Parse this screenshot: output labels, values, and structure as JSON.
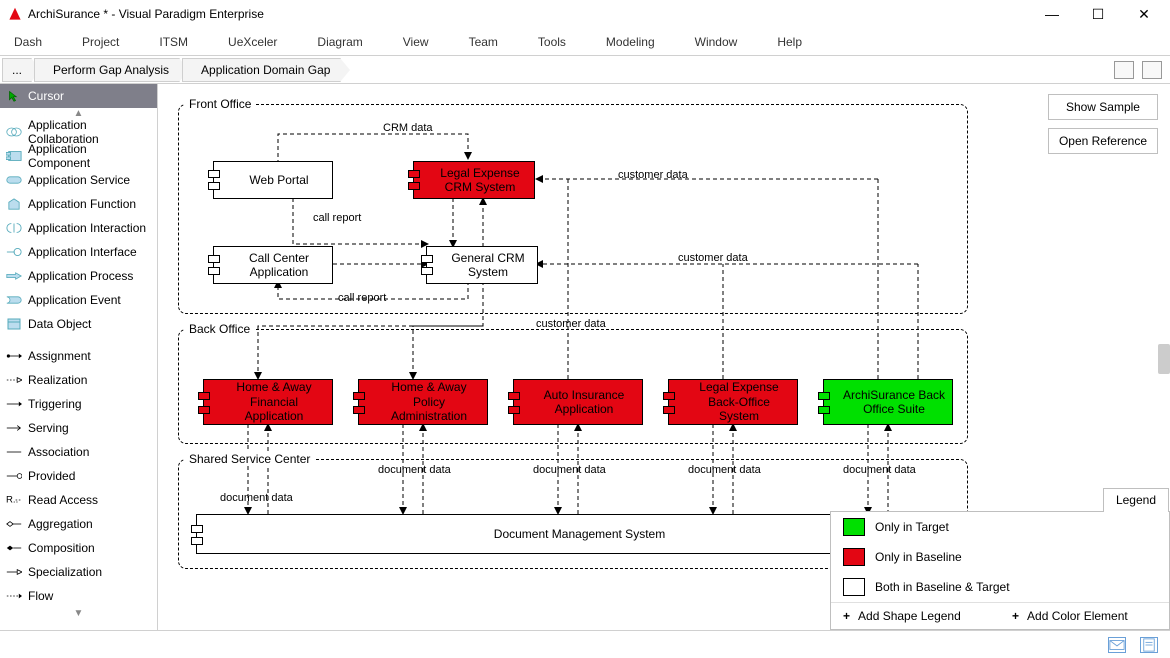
{
  "window": {
    "title": "ArchiSurance * - Visual Paradigm Enterprise"
  },
  "menu": {
    "items": [
      "Dash",
      "Project",
      "ITSM",
      "UeXceler",
      "Diagram",
      "View",
      "Team",
      "Tools",
      "Modeling",
      "Window",
      "Help"
    ]
  },
  "breadcrumb": {
    "root": "...",
    "items": [
      "Perform Gap Analysis",
      "Application Domain Gap"
    ]
  },
  "palette": {
    "selected": "Cursor",
    "shapes": [
      "Application Collaboration",
      "Application Component",
      "Application Service",
      "Application Function",
      "Application Interaction",
      "Application Interface",
      "Application Process",
      "Application Event",
      "Data Object"
    ],
    "connectors": [
      "Assignment",
      "Realization",
      "Triggering",
      "Serving",
      "Association",
      "Provided",
      "Read Access",
      "Aggregation",
      "Composition",
      "Specialization",
      "Flow"
    ]
  },
  "actions": {
    "sample": "Show Sample",
    "reference": "Open Reference"
  },
  "diagram": {
    "groups": {
      "front": {
        "label": "Front Office"
      },
      "back": {
        "label": "Back Office"
      },
      "shared": {
        "label": "Shared Service Center"
      }
    },
    "components": {
      "web_portal": "Web Portal",
      "legal_crm": "Legal Expense CRM System",
      "call_center": "Call Center Application",
      "general_crm": "General CRM System",
      "home_fin": "Home & Away Financial Application",
      "home_pol": "Home & Away Policy Administration",
      "auto_ins": "Auto Insurance Application",
      "legal_back": "Legal Expense Back-Office System",
      "archi_suite": "ArchiSurance Back Office Suite",
      "doc_mgmt": "Document Management System"
    },
    "labels": {
      "crm_data": "CRM data",
      "customer_data": "customer data",
      "customer_data2": "customer data",
      "customer_data3": "customer data",
      "call_report": "call report",
      "call_report2": "call report",
      "doc_data": "document data",
      "doc_data1": "document data",
      "doc_data2": "document data",
      "doc_data3": "document data",
      "doc_data4": "document data"
    }
  },
  "legend": {
    "title": "Legend",
    "items": [
      {
        "color": "#00e000",
        "label": "Only in Target"
      },
      {
        "color": "#e30613",
        "label": "Only in Baseline"
      },
      {
        "color": "#ffffff",
        "label": "Both  in Baseline & Target"
      }
    ],
    "add_shape": "Add Shape Legend",
    "add_color": "Add Color Element"
  },
  "colors": {
    "red": "#e30613",
    "green": "#00e000"
  }
}
